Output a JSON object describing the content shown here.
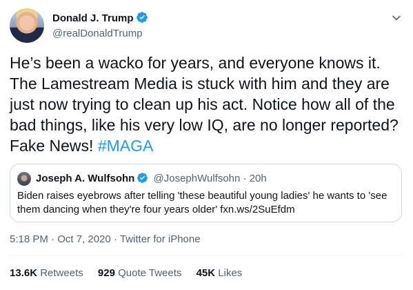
{
  "author": {
    "display_name": "Donald J. Trump",
    "handle": "@realDonaldTrump"
  },
  "tweet": {
    "text": "He’s been a wacko for years, and everyone knows it. The Lamestream Media is stuck with him and they are just now trying to clean up his act. Notice how all of the bad things, like his very low IQ, are no longer reported? Fake News!",
    "hashtag": "#MAGA"
  },
  "quote": {
    "display_name": "Joseph A. Wulfsohn",
    "handle": "@JosephWulfsohn",
    "separator": "·",
    "time": "20h",
    "text": "Biden raises eyebrows after telling 'these beautiful young ladies' he wants to 'see them dancing when they're four years older' fxn.ws/2SuEfdm"
  },
  "meta": {
    "time": "5:18 PM",
    "separator1": "·",
    "date": "Oct 7, 2020",
    "separator2": "·",
    "source": "Twitter for iPhone"
  },
  "stats": {
    "retweets_count": "13.6K",
    "retweets_label": "Retweets",
    "quotes_count": "929",
    "quotes_label": "Quote Tweets",
    "likes_count": "45K",
    "likes_label": "Likes"
  },
  "colors": {
    "accent": "#1d9bf0",
    "secondary_text": "#536471",
    "border": "#cfd9de"
  },
  "icons": {
    "verified": "verified-badge-icon",
    "caret": "chevron-down-icon"
  }
}
